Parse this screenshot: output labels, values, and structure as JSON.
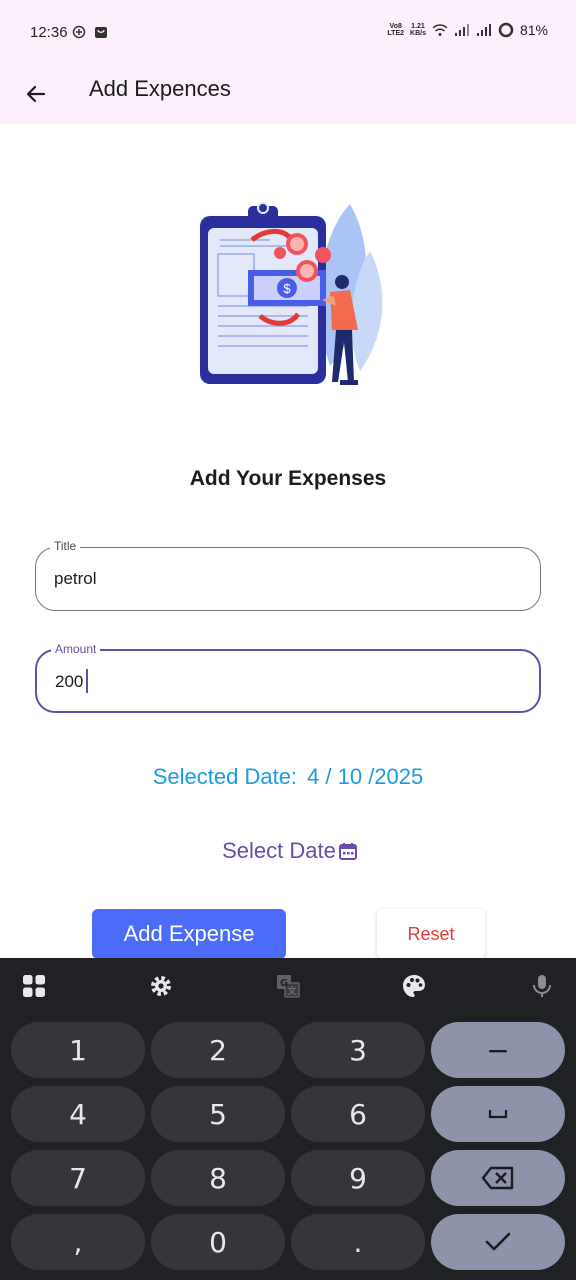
{
  "status_bar": {
    "time": "12:36",
    "net_top": "Vo8",
    "net_bottom": "LTE2",
    "speed_top": "1.21",
    "speed_bottom": "KB/s",
    "battery": "81%"
  },
  "app_bar": {
    "title": "Add Expences"
  },
  "heading": "Add Your Expenses",
  "title_field": {
    "label": "Title",
    "value": "petrol"
  },
  "amount_field": {
    "label": "Amount",
    "value": "200"
  },
  "selected_date": {
    "label": "Selected Date:",
    "value": "4 / 10 /2025"
  },
  "select_date_button": {
    "label": "Select Date"
  },
  "add_button": {
    "label": "Add Expense"
  },
  "reset_button": {
    "label": "Reset"
  },
  "colors": {
    "accent": "#6a4ca8",
    "primary_button": "#4a6cf7",
    "date_text": "#1b9ce0",
    "reset_text": "#e53935",
    "app_bar_bg": "#fbf0fb",
    "keyboard_bg": "#1f2125"
  },
  "keyboard": {
    "toolbar_icons": [
      "apps-grid-icon",
      "gear-icon",
      "translate-icon",
      "palette-icon",
      "mic-icon"
    ],
    "keys": [
      "1",
      "2",
      "3",
      "−",
      "4",
      "5",
      "6",
      "␣",
      "7",
      "8",
      "9",
      "⌫",
      ",",
      "0",
      ".",
      "✓"
    ]
  }
}
